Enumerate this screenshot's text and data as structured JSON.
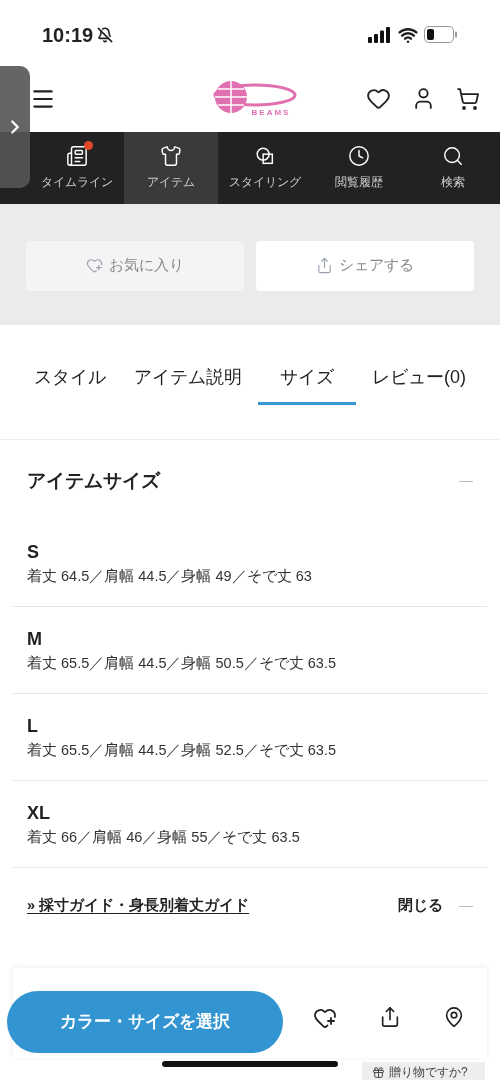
{
  "status_bar": {
    "time": "10:19"
  },
  "header": {
    "logo_text": "BEAMS"
  },
  "nav": [
    {
      "label": "タイムライン",
      "selected": false,
      "badge": true
    },
    {
      "label": "アイテム",
      "selected": true,
      "badge": false
    },
    {
      "label": "スタイリング",
      "selected": false,
      "badge": false
    },
    {
      "label": "閲覧履歴",
      "selected": false,
      "badge": false
    },
    {
      "label": "検索",
      "selected": false,
      "badge": false
    }
  ],
  "actions": [
    {
      "label": "お気に入り"
    },
    {
      "label": "シェアする"
    }
  ],
  "tabs": [
    {
      "label": "スタイル",
      "selected": false
    },
    {
      "label": "アイテム説明",
      "selected": false
    },
    {
      "label": "サイズ",
      "selected": true
    },
    {
      "label": "レビュー(0)",
      "selected": false
    }
  ],
  "section": {
    "title": "アイテムサイズ",
    "expanded": true,
    "sizes": [
      {
        "name": "S",
        "measures": "着丈 64.5／肩幅 44.5／身幅 49／そで丈 63"
      },
      {
        "name": "M",
        "measures": "着丈 65.5／肩幅 44.5／身幅 50.5／そで丈 63.5"
      },
      {
        "name": "L",
        "measures": "着丈 65.5／肩幅 44.5／身幅 52.5／そで丈 63.5"
      },
      {
        "name": "XL",
        "measures": "着丈 66／肩幅 46／身幅 55／そで丈 63.5"
      }
    ],
    "guide_link": "» 採寸ガイド・身長別着丈ガイド",
    "close_label": "閉じる"
  },
  "bottom_bar": {
    "select_button": "カラー・サイズを選択",
    "gift_label": "贈り物ですか?"
  }
}
